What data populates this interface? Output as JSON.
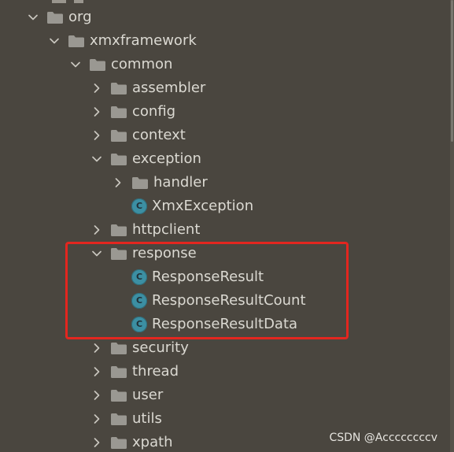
{
  "tree": {
    "items": [
      {
        "label": "org",
        "type": "folder",
        "expanded": true,
        "depth": 0
      },
      {
        "label": "xmxframework",
        "type": "folder",
        "expanded": true,
        "depth": 1
      },
      {
        "label": "common",
        "type": "folder",
        "expanded": true,
        "depth": 2
      },
      {
        "label": "assembler",
        "type": "folder",
        "expanded": false,
        "depth": 3
      },
      {
        "label": "config",
        "type": "folder",
        "expanded": false,
        "depth": 3
      },
      {
        "label": "context",
        "type": "folder",
        "expanded": false,
        "depth": 3
      },
      {
        "label": "exception",
        "type": "folder",
        "expanded": true,
        "depth": 3
      },
      {
        "label": "handler",
        "type": "folder",
        "expanded": false,
        "depth": 4
      },
      {
        "label": "XmxException",
        "type": "class",
        "depth": 4
      },
      {
        "label": "httpclient",
        "type": "folder",
        "expanded": false,
        "depth": 3
      },
      {
        "label": "response",
        "type": "folder",
        "expanded": true,
        "depth": 3
      },
      {
        "label": "ResponseResult",
        "type": "class",
        "depth": 4
      },
      {
        "label": "ResponseResultCount",
        "type": "class",
        "depth": 4
      },
      {
        "label": "ResponseResultData",
        "type": "class",
        "depth": 4
      },
      {
        "label": "security",
        "type": "folder",
        "expanded": false,
        "depth": 3
      },
      {
        "label": "thread",
        "type": "folder",
        "expanded": false,
        "depth": 3
      },
      {
        "label": "user",
        "type": "folder",
        "expanded": false,
        "depth": 3
      },
      {
        "label": "utils",
        "type": "folder",
        "expanded": false,
        "depth": 3
      },
      {
        "label": "xpath",
        "type": "folder",
        "expanded": false,
        "depth": 3
      }
    ]
  },
  "icons": {
    "class_letter": "C",
    "folder_color": "#9a9892",
    "class_color": "#3c8fa3",
    "highlight_color": "#e3261f"
  },
  "watermark": "CSDN @Accccccccv"
}
